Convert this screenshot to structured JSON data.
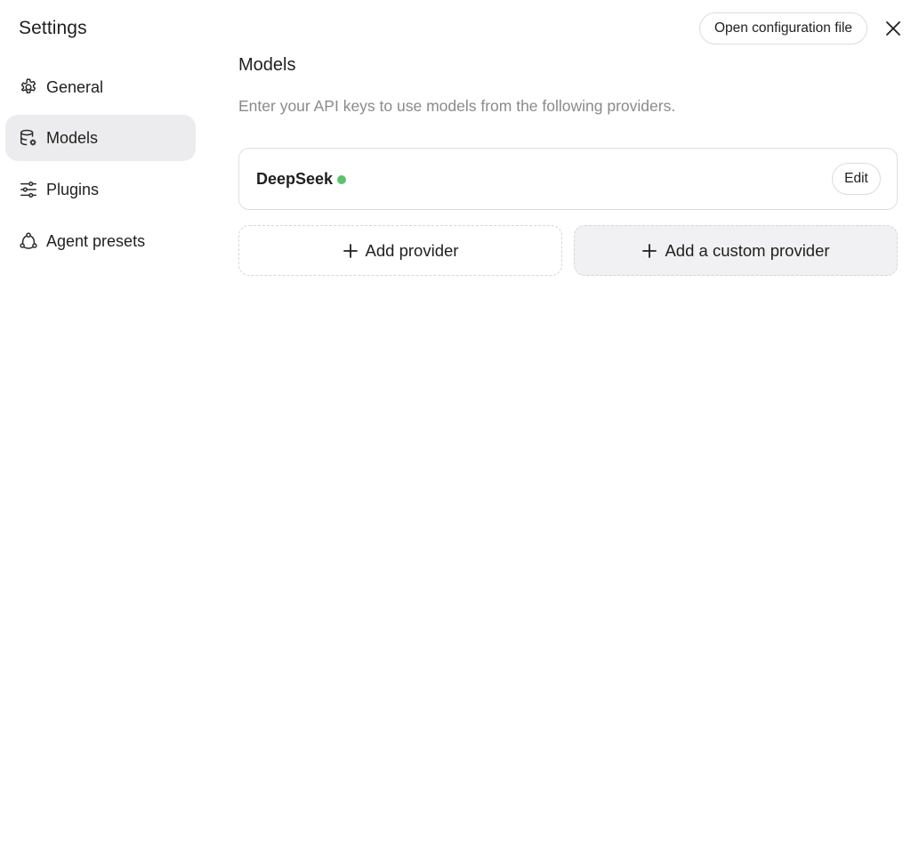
{
  "sidebar": {
    "title": "Settings",
    "items": [
      {
        "label": "General",
        "icon": "gear-icon",
        "active": false
      },
      {
        "label": "Models",
        "icon": "database-gear-icon",
        "active": true
      },
      {
        "label": "Plugins",
        "icon": "sliders-icon",
        "active": false
      },
      {
        "label": "Agent presets",
        "icon": "agent-nodes-icon",
        "active": false
      }
    ]
  },
  "header": {
    "open_config_label": "Open configuration file",
    "close_icon": "close-icon"
  },
  "main": {
    "title": "Models",
    "subtitle": "Enter your API keys to use models from the following providers.",
    "providers": [
      {
        "name": "DeepSeek",
        "status_color": "#5cc36a",
        "edit_label": "Edit"
      }
    ],
    "add_provider_label": "Add provider",
    "add_custom_provider_label": "Add a custom provider"
  },
  "colors": {
    "active_nav_bg": "#ececee",
    "status_ok": "#5cc36a",
    "subtitle": "#8a8a8a"
  }
}
